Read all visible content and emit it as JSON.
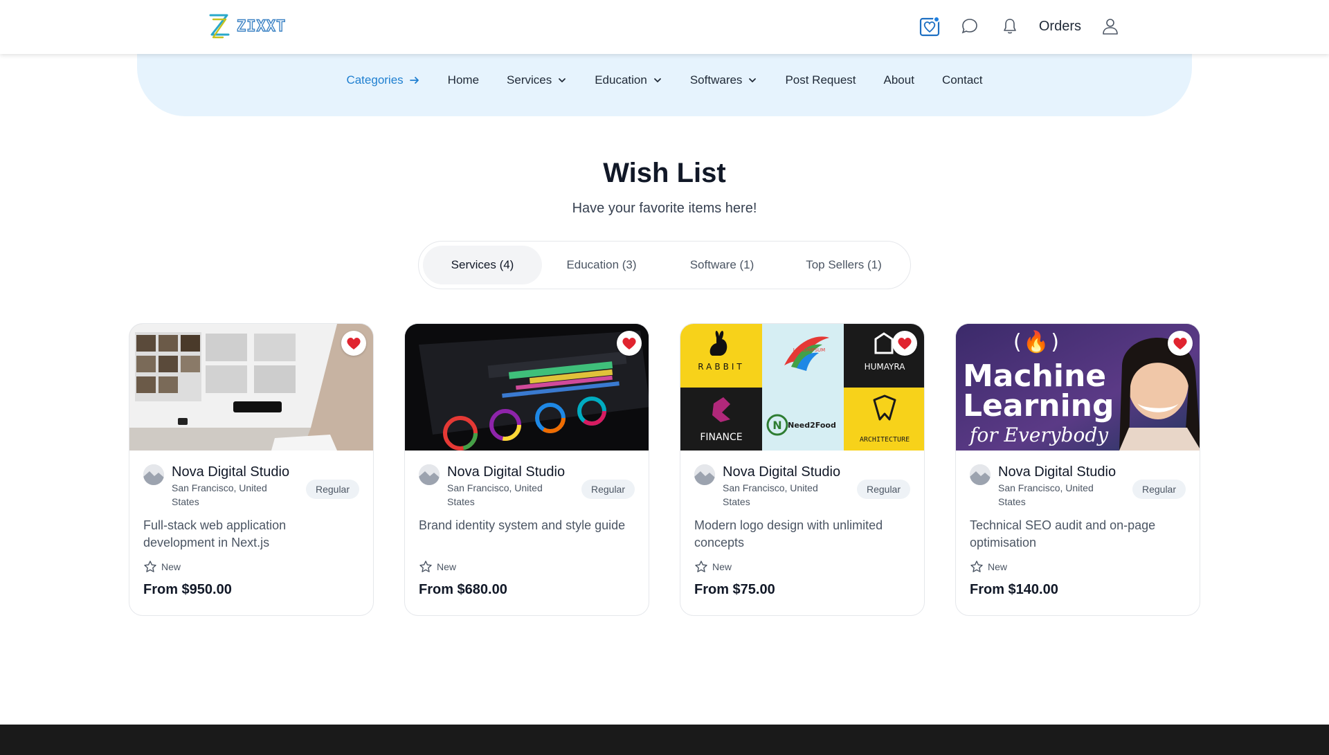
{
  "header": {
    "logo_text": "ZIXXT",
    "orders_label": "Orders"
  },
  "nav": {
    "categories": "Categories",
    "items": [
      "Home",
      "Services",
      "Education",
      "Softwares",
      "Post Request",
      "About",
      "Contact"
    ]
  },
  "page": {
    "title": "Wish List",
    "subtitle": "Have your favorite items here!"
  },
  "tabs": [
    {
      "label": "Services (4)",
      "active": true
    },
    {
      "label": "Education (3)",
      "active": false
    },
    {
      "label": "Software (1)",
      "active": false
    },
    {
      "label": "Top Sellers (1)",
      "active": false
    }
  ],
  "cards": [
    {
      "seller": "Nova Digital Studio",
      "location": "San Francisco, United States",
      "badge": "Regular",
      "title": "Full-stack web application development in Next.js",
      "rating": "New",
      "price": "From $950.00"
    },
    {
      "seller": "Nova Digital Studio",
      "location": "San Francisco, United States",
      "badge": "Regular",
      "title": "Brand identity system and style guide",
      "rating": "New",
      "price": "From $680.00"
    },
    {
      "seller": "Nova Digital Studio",
      "location": "San Francisco, United States",
      "badge": "Regular",
      "title": "Modern logo design with unlimited concepts",
      "rating": "New",
      "price": "From $75.00",
      "logos": [
        "RABBIT",
        "LOREMIPSUM",
        "HUMAYRA",
        "FINANCE",
        "Need2Food",
        "ARCHITECTURE"
      ]
    },
    {
      "seller": "Nova Digital Studio",
      "location": "San Francisco, United States",
      "badge": "Regular",
      "title": "Technical SEO audit and on-page optimisation",
      "rating": "New",
      "price": "From $140.00",
      "thumb_text": [
        "Machine",
        "Learning",
        "for Everybody"
      ]
    }
  ],
  "colors": {
    "accent": "#1f7fd0",
    "nav_band": "#e6f3fd",
    "heart": "#e0242f"
  }
}
